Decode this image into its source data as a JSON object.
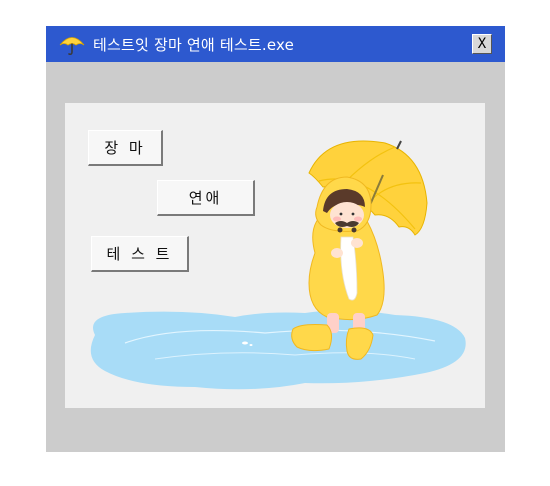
{
  "window": {
    "title": "테스트잇 장마 연애 테스트.exe",
    "close_label": "X",
    "icon": "umbrella-icon"
  },
  "menu": {
    "items": [
      {
        "label": "장 마"
      },
      {
        "label": "연애"
      },
      {
        "label": "테 스 트"
      }
    ]
  },
  "colors": {
    "titlebar": "#2d59cf",
    "window_bg": "#cccccc",
    "panel_bg": "#f0f0f0",
    "raincoat": "#ffd84a",
    "umbrella": "#ffd23c",
    "puddle": "#a8dcf7"
  }
}
